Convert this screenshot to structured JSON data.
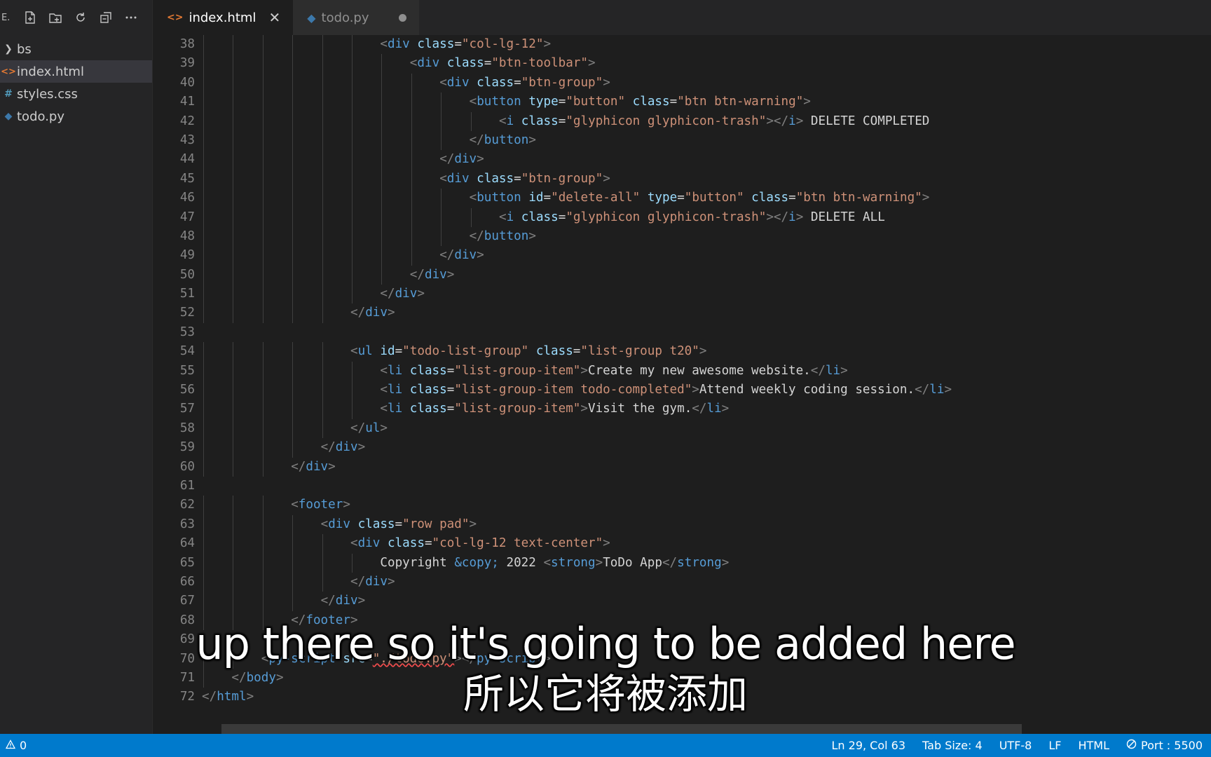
{
  "sidebar": {
    "title_fragment": "E.",
    "items": [
      {
        "label": "bs",
        "icon": "chevron-right-icon",
        "active": false
      },
      {
        "label": "index.html",
        "icon": "html-file-icon",
        "active": true
      },
      {
        "label": "styles.css",
        "icon": "css-file-icon",
        "active": false
      },
      {
        "label": "todo.py",
        "icon": "python-file-icon",
        "active": false
      }
    ]
  },
  "tabs": [
    {
      "label": "index.html",
      "icon": "html-file-icon",
      "active": true
    },
    {
      "label": "todo.py",
      "icon": "python-file-icon",
      "active": false,
      "dirty": true
    }
  ],
  "editor": {
    "lines": [
      {
        "n": "38",
        "indent": 12,
        "tokens": [
          [
            "br",
            "<"
          ],
          [
            "tag",
            "div"
          ],
          [
            "txt",
            " "
          ],
          [
            "at",
            "class"
          ],
          [
            "eq",
            "="
          ],
          [
            "str",
            "\"col-lg-12\""
          ],
          [
            "br",
            ">"
          ]
        ]
      },
      {
        "n": "39",
        "indent": 14,
        "tokens": [
          [
            "br",
            "<"
          ],
          [
            "tag",
            "div"
          ],
          [
            "txt",
            " "
          ],
          [
            "at",
            "class"
          ],
          [
            "eq",
            "="
          ],
          [
            "str",
            "\"btn-toolbar\""
          ],
          [
            "br",
            ">"
          ]
        ]
      },
      {
        "n": "40",
        "indent": 16,
        "tokens": [
          [
            "br",
            "<"
          ],
          [
            "tag",
            "div"
          ],
          [
            "txt",
            " "
          ],
          [
            "at",
            "class"
          ],
          [
            "eq",
            "="
          ],
          [
            "str",
            "\"btn-group\""
          ],
          [
            "br",
            ">"
          ]
        ]
      },
      {
        "n": "41",
        "indent": 18,
        "tokens": [
          [
            "br",
            "<"
          ],
          [
            "tag",
            "button"
          ],
          [
            "txt",
            " "
          ],
          [
            "at",
            "type"
          ],
          [
            "eq",
            "="
          ],
          [
            "str",
            "\"button\""
          ],
          [
            "txt",
            " "
          ],
          [
            "at",
            "class"
          ],
          [
            "eq",
            "="
          ],
          [
            "str",
            "\"btn btn-warning\""
          ],
          [
            "br",
            ">"
          ]
        ]
      },
      {
        "n": "42",
        "indent": 20,
        "tokens": [
          [
            "br",
            "<"
          ],
          [
            "tag",
            "i"
          ],
          [
            "txt",
            " "
          ],
          [
            "at",
            "class"
          ],
          [
            "eq",
            "="
          ],
          [
            "str",
            "\"glyphicon glyphicon-trash\""
          ],
          [
            "br",
            "></"
          ],
          [
            "tag",
            "i"
          ],
          [
            "br",
            ">"
          ],
          [
            "txt",
            " DELETE COMPLETED"
          ]
        ]
      },
      {
        "n": "43",
        "indent": 18,
        "tokens": [
          [
            "br",
            "</"
          ],
          [
            "tag",
            "button"
          ],
          [
            "br",
            ">"
          ]
        ]
      },
      {
        "n": "44",
        "indent": 16,
        "tokens": [
          [
            "br",
            "</"
          ],
          [
            "tag",
            "div"
          ],
          [
            "br",
            ">"
          ]
        ]
      },
      {
        "n": "45",
        "indent": 16,
        "tokens": [
          [
            "br",
            "<"
          ],
          [
            "tag",
            "div"
          ],
          [
            "txt",
            " "
          ],
          [
            "at",
            "class"
          ],
          [
            "eq",
            "="
          ],
          [
            "str",
            "\"btn-group\""
          ],
          [
            "br",
            ">"
          ]
        ]
      },
      {
        "n": "46",
        "indent": 18,
        "tokens": [
          [
            "br",
            "<"
          ],
          [
            "tag",
            "button"
          ],
          [
            "txt",
            " "
          ],
          [
            "at",
            "id"
          ],
          [
            "eq",
            "="
          ],
          [
            "str",
            "\"delete-all\""
          ],
          [
            "txt",
            " "
          ],
          [
            "at",
            "type"
          ],
          [
            "eq",
            "="
          ],
          [
            "str",
            "\"button\""
          ],
          [
            "txt",
            " "
          ],
          [
            "at",
            "class"
          ],
          [
            "eq",
            "="
          ],
          [
            "str",
            "\"btn btn-warning\""
          ],
          [
            "br",
            ">"
          ]
        ]
      },
      {
        "n": "47",
        "indent": 20,
        "tokens": [
          [
            "br",
            "<"
          ],
          [
            "tag",
            "i"
          ],
          [
            "txt",
            " "
          ],
          [
            "at",
            "class"
          ],
          [
            "eq",
            "="
          ],
          [
            "str",
            "\"glyphicon glyphicon-trash\""
          ],
          [
            "br",
            "></"
          ],
          [
            "tag",
            "i"
          ],
          [
            "br",
            ">"
          ],
          [
            "txt",
            " DELETE ALL"
          ]
        ]
      },
      {
        "n": "48",
        "indent": 18,
        "tokens": [
          [
            "br",
            "</"
          ],
          [
            "tag",
            "button"
          ],
          [
            "br",
            ">"
          ]
        ]
      },
      {
        "n": "49",
        "indent": 16,
        "tokens": [
          [
            "br",
            "</"
          ],
          [
            "tag",
            "div"
          ],
          [
            "br",
            ">"
          ]
        ]
      },
      {
        "n": "50",
        "indent": 14,
        "tokens": [
          [
            "br",
            "</"
          ],
          [
            "tag",
            "div"
          ],
          [
            "br",
            ">"
          ]
        ]
      },
      {
        "n": "51",
        "indent": 12,
        "tokens": [
          [
            "br",
            "</"
          ],
          [
            "tag",
            "div"
          ],
          [
            "br",
            ">"
          ]
        ]
      },
      {
        "n": "52",
        "indent": 10,
        "tokens": [
          [
            "br",
            "</"
          ],
          [
            "tag",
            "div"
          ],
          [
            "br",
            ">"
          ]
        ]
      },
      {
        "n": "53",
        "indent": 0,
        "tokens": []
      },
      {
        "n": "54",
        "indent": 10,
        "tokens": [
          [
            "br",
            "<"
          ],
          [
            "tag",
            "ul"
          ],
          [
            "txt",
            " "
          ],
          [
            "at",
            "id"
          ],
          [
            "eq",
            "="
          ],
          [
            "str",
            "\"todo-list-group\""
          ],
          [
            "txt",
            " "
          ],
          [
            "at",
            "class"
          ],
          [
            "eq",
            "="
          ],
          [
            "str",
            "\"list-group t20\""
          ],
          [
            "br",
            ">"
          ]
        ]
      },
      {
        "n": "55",
        "indent": 12,
        "tokens": [
          [
            "br",
            "<"
          ],
          [
            "tag",
            "li"
          ],
          [
            "txt",
            " "
          ],
          [
            "at",
            "class"
          ],
          [
            "eq",
            "="
          ],
          [
            "str",
            "\"list-group-item\""
          ],
          [
            "br",
            ">"
          ],
          [
            "txt",
            "Create my new awesome website."
          ],
          [
            "br",
            "</"
          ],
          [
            "tag",
            "li"
          ],
          [
            "br",
            ">"
          ]
        ]
      },
      {
        "n": "56",
        "indent": 12,
        "tokens": [
          [
            "br",
            "<"
          ],
          [
            "tag",
            "li"
          ],
          [
            "txt",
            " "
          ],
          [
            "at",
            "class"
          ],
          [
            "eq",
            "="
          ],
          [
            "str",
            "\"list-group-item todo-completed\""
          ],
          [
            "br",
            ">"
          ],
          [
            "txt",
            "Attend weekly coding session."
          ],
          [
            "br",
            "</"
          ],
          [
            "tag",
            "li"
          ],
          [
            "br",
            ">"
          ]
        ]
      },
      {
        "n": "57",
        "indent": 12,
        "tokens": [
          [
            "br",
            "<"
          ],
          [
            "tag",
            "li"
          ],
          [
            "txt",
            " "
          ],
          [
            "at",
            "class"
          ],
          [
            "eq",
            "="
          ],
          [
            "str",
            "\"list-group-item\""
          ],
          [
            "br",
            ">"
          ],
          [
            "txt",
            "Visit the gym."
          ],
          [
            "br",
            "</"
          ],
          [
            "tag",
            "li"
          ],
          [
            "br",
            ">"
          ]
        ]
      },
      {
        "n": "58",
        "indent": 10,
        "tokens": [
          [
            "br",
            "</"
          ],
          [
            "tag",
            "ul"
          ],
          [
            "br",
            ">"
          ]
        ]
      },
      {
        "n": "59",
        "indent": 8,
        "tokens": [
          [
            "br",
            "</"
          ],
          [
            "tag",
            "div"
          ],
          [
            "br",
            ">"
          ]
        ]
      },
      {
        "n": "60",
        "indent": 6,
        "tokens": [
          [
            "br",
            "</"
          ],
          [
            "tag",
            "div"
          ],
          [
            "br",
            ">"
          ]
        ]
      },
      {
        "n": "61",
        "indent": 0,
        "tokens": []
      },
      {
        "n": "62",
        "indent": 6,
        "tokens": [
          [
            "br",
            "<"
          ],
          [
            "tag",
            "footer"
          ],
          [
            "br",
            ">"
          ]
        ]
      },
      {
        "n": "63",
        "indent": 8,
        "tokens": [
          [
            "br",
            "<"
          ],
          [
            "tag",
            "div"
          ],
          [
            "txt",
            " "
          ],
          [
            "at",
            "class"
          ],
          [
            "eq",
            "="
          ],
          [
            "str",
            "\"row pad\""
          ],
          [
            "br",
            ">"
          ]
        ]
      },
      {
        "n": "64",
        "indent": 10,
        "tokens": [
          [
            "br",
            "<"
          ],
          [
            "tag",
            "div"
          ],
          [
            "txt",
            " "
          ],
          [
            "at",
            "class"
          ],
          [
            "eq",
            "="
          ],
          [
            "str",
            "\"col-lg-12 text-center\""
          ],
          [
            "br",
            ">"
          ]
        ]
      },
      {
        "n": "65",
        "indent": 12,
        "tokens": [
          [
            "txt",
            "Copyright "
          ],
          [
            "ent",
            "&copy;"
          ],
          [
            "txt",
            " 2022 "
          ],
          [
            "br",
            "<"
          ],
          [
            "tag",
            "strong"
          ],
          [
            "br",
            ">"
          ],
          [
            "txt",
            "ToDo App"
          ],
          [
            "br",
            "</"
          ],
          [
            "tag",
            "strong"
          ],
          [
            "br",
            ">"
          ]
        ]
      },
      {
        "n": "66",
        "indent": 10,
        "tokens": [
          [
            "br",
            "</"
          ],
          [
            "tag",
            "div"
          ],
          [
            "br",
            ">"
          ]
        ]
      },
      {
        "n": "67",
        "indent": 8,
        "tokens": [
          [
            "br",
            "</"
          ],
          [
            "tag",
            "div"
          ],
          [
            "br",
            ">"
          ]
        ]
      },
      {
        "n": "68",
        "indent": 6,
        "tokens": [
          [
            "br",
            "</"
          ],
          [
            "tag",
            "footer"
          ],
          [
            "br",
            ">"
          ]
        ]
      },
      {
        "n": "69",
        "indent": 0,
        "tokens": []
      },
      {
        "n": "70",
        "indent": 4,
        "tokens": [
          [
            "br",
            "<"
          ],
          [
            "tag",
            "py-script"
          ],
          [
            "txt",
            " "
          ],
          [
            "at",
            "src"
          ],
          [
            "eq",
            "="
          ],
          [
            "err",
            "\"./todo.py\""
          ],
          [
            "br",
            "></"
          ],
          [
            "tag",
            "py-script"
          ],
          [
            "br",
            ">"
          ]
        ]
      },
      {
        "n": "71",
        "indent": 2,
        "tokens": [
          [
            "br",
            "</"
          ],
          [
            "tag",
            "body"
          ],
          [
            "br",
            ">"
          ]
        ]
      },
      {
        "n": "72",
        "indent": 0,
        "tokens": [
          [
            "br",
            "</"
          ],
          [
            "tag",
            "html"
          ],
          [
            "br",
            ">"
          ]
        ]
      }
    ]
  },
  "subtitles": {
    "english": "up there so it's going to be added here",
    "chinese": "所以它将被添加"
  },
  "status_bar": {
    "problems_count": "0",
    "cursor_position": "Ln 29, Col 63",
    "tab_size": "Tab Size: 4",
    "encoding": "UTF-8",
    "line_ending": "LF",
    "language": "HTML",
    "port": "Port : 5500"
  },
  "colors": {
    "status_bar": "#007acc",
    "editor_bg": "#1e1e1e",
    "sidebar_bg": "#252526",
    "tag": "#569cd6",
    "attribute": "#9cdcfe",
    "string": "#ce9178"
  }
}
